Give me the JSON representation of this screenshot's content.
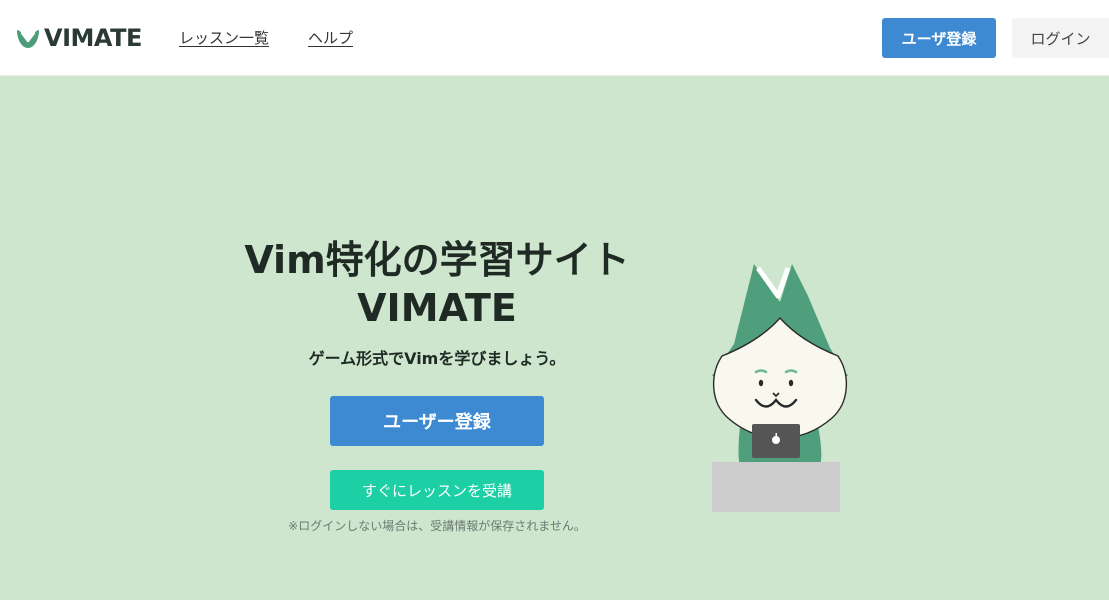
{
  "header": {
    "logo_text": "VIMATE",
    "nav": {
      "lessons": "レッスン一覧",
      "help": "ヘルプ"
    },
    "register_label": "ユーザ登録",
    "login_label": "ログイン"
  },
  "hero": {
    "title_line1": "Vim特化の学習サイト",
    "title_line2": "VIMATE",
    "subtitle": "ゲーム形式でVimを学びましょう。",
    "register_button": "ユーザー登録",
    "trial_button": "すぐにレッスンを受講",
    "note": "※ログインしない場合は、受講情報が保存されません。"
  },
  "colors": {
    "hero_bg": "#cde6cd",
    "primary_blue": "#3d8ad3",
    "trial_green": "#1ccfa4",
    "brand_green": "#4a9d78"
  },
  "icons": {
    "logo_mark": "vimate-logo-icon",
    "mascot": "vimate-mascot-illustration"
  }
}
